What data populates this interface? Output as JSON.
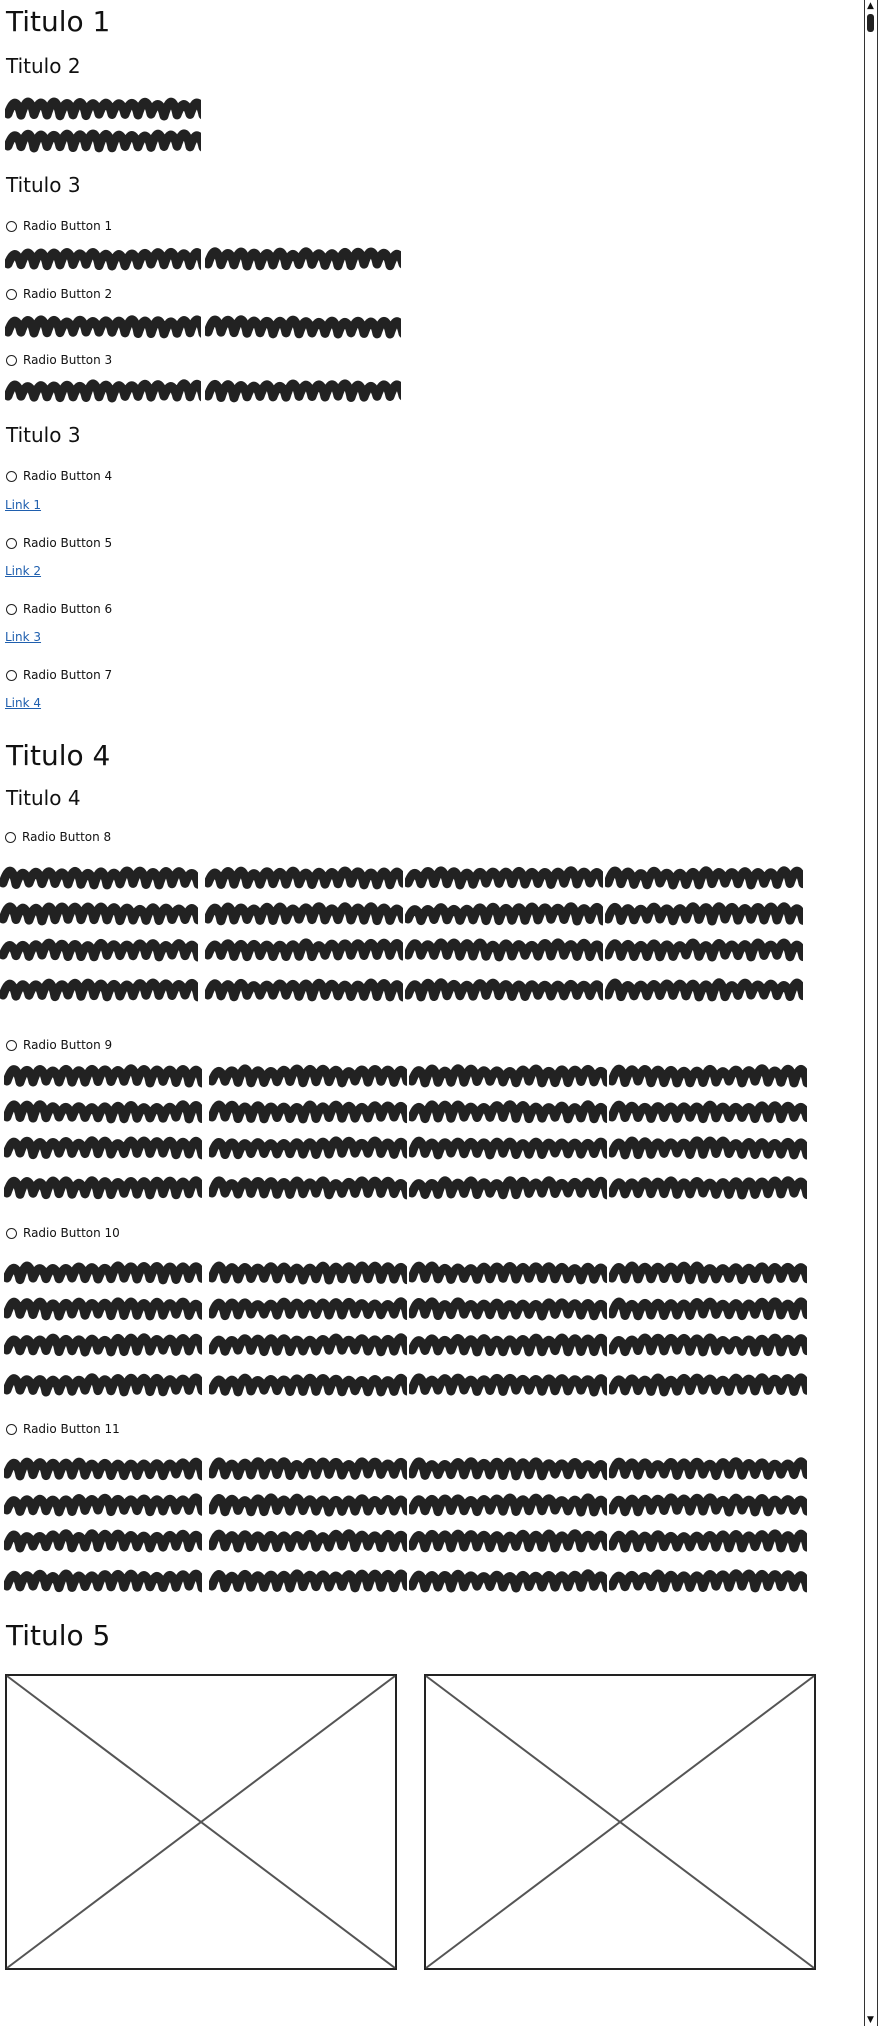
{
  "sections": {
    "title1": "Titulo 1",
    "title2": "Titulo 2",
    "title3a": "Titulo 3",
    "title3b": "Titulo 3",
    "title4_large": "Titulo 4",
    "title4_small": "Titulo 4",
    "title5": "Titulo 5"
  },
  "radios": {
    "r1": "Radio Button 1",
    "r2": "Radio Button 2",
    "r3": "Radio Button 3",
    "r4": "Radio Button 4",
    "r5": "Radio Button 5",
    "r6": "Radio Button 6",
    "r7": "Radio Button 7",
    "r8": "Radio Button 8",
    "r9": "Radio Button 9",
    "r10": "Radio Button 10",
    "r11": "Radio Button 11"
  },
  "links": {
    "l1": "Link 1",
    "l2": "Link 2",
    "l3": "Link 3",
    "l4": "Link 4"
  },
  "scrollbar": {
    "up_icon": "▲",
    "down_icon": "▼"
  },
  "colors": {
    "scribble": "#222222",
    "link": "#1f5fae",
    "placeholder_stroke": "#555555"
  }
}
